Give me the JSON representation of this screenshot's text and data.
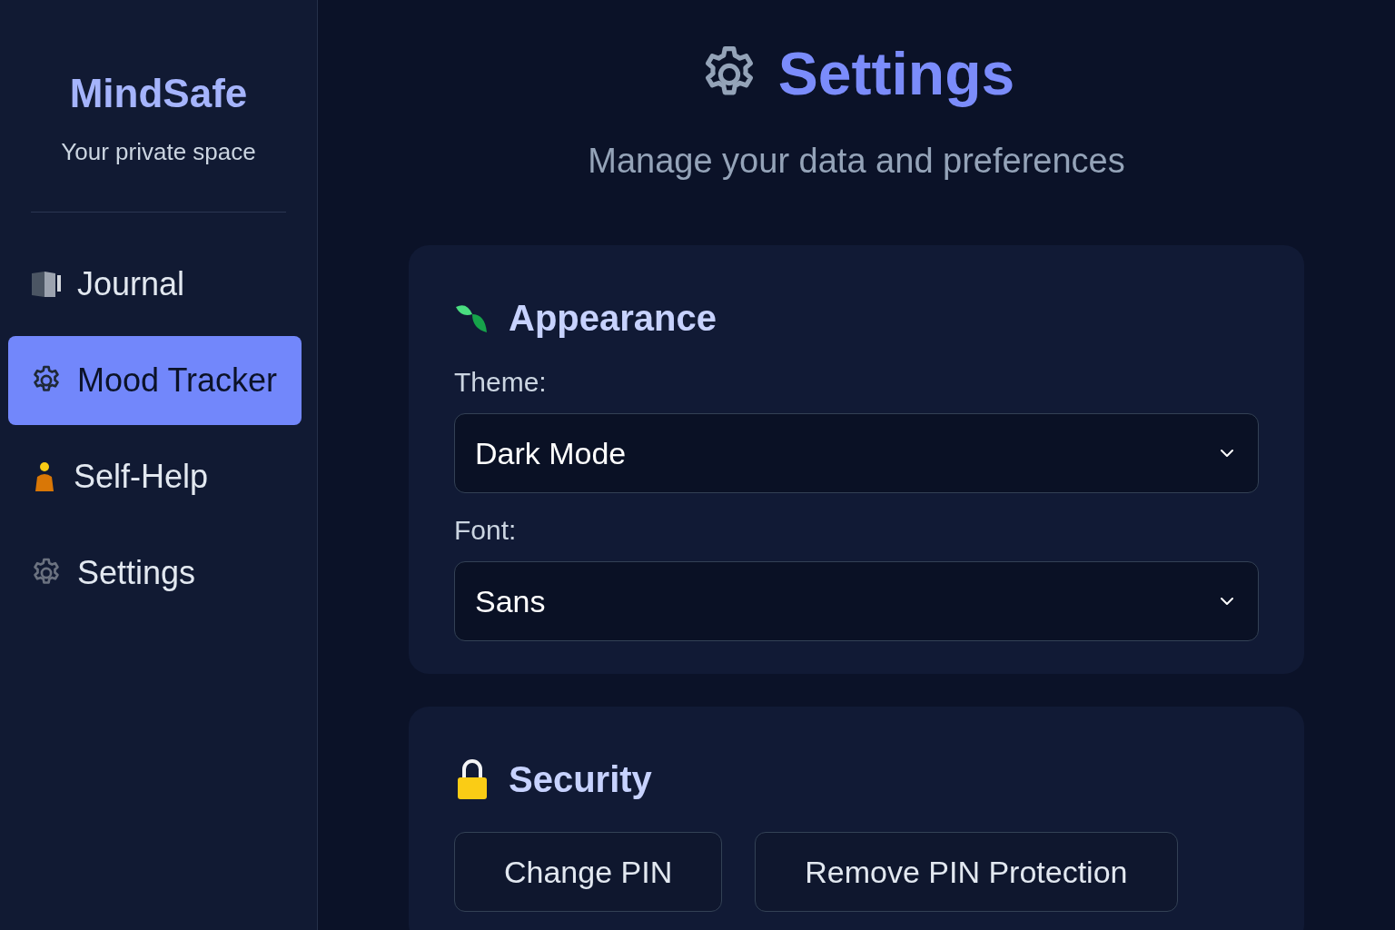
{
  "sidebar": {
    "app_name": "MindSafe",
    "tagline": "Your private space",
    "items": [
      {
        "label": "Journal",
        "selected": false
      },
      {
        "label": "Mood Tracker",
        "selected": true
      },
      {
        "label": "Self-Help",
        "selected": false
      },
      {
        "label": "Settings",
        "selected": false
      }
    ]
  },
  "header": {
    "title": "Settings",
    "subtitle": "Manage your data and preferences"
  },
  "sections": [
    {
      "kind": "form",
      "title": "Appearance",
      "fields": [
        {
          "label": "Theme:",
          "value": "Dark Mode"
        },
        {
          "label": "Font:",
          "value": "Sans"
        }
      ]
    },
    {
      "kind": "buttons",
      "title": "Security",
      "buttons": [
        "Change PIN",
        "Remove PIN Protection"
      ]
    }
  ]
}
